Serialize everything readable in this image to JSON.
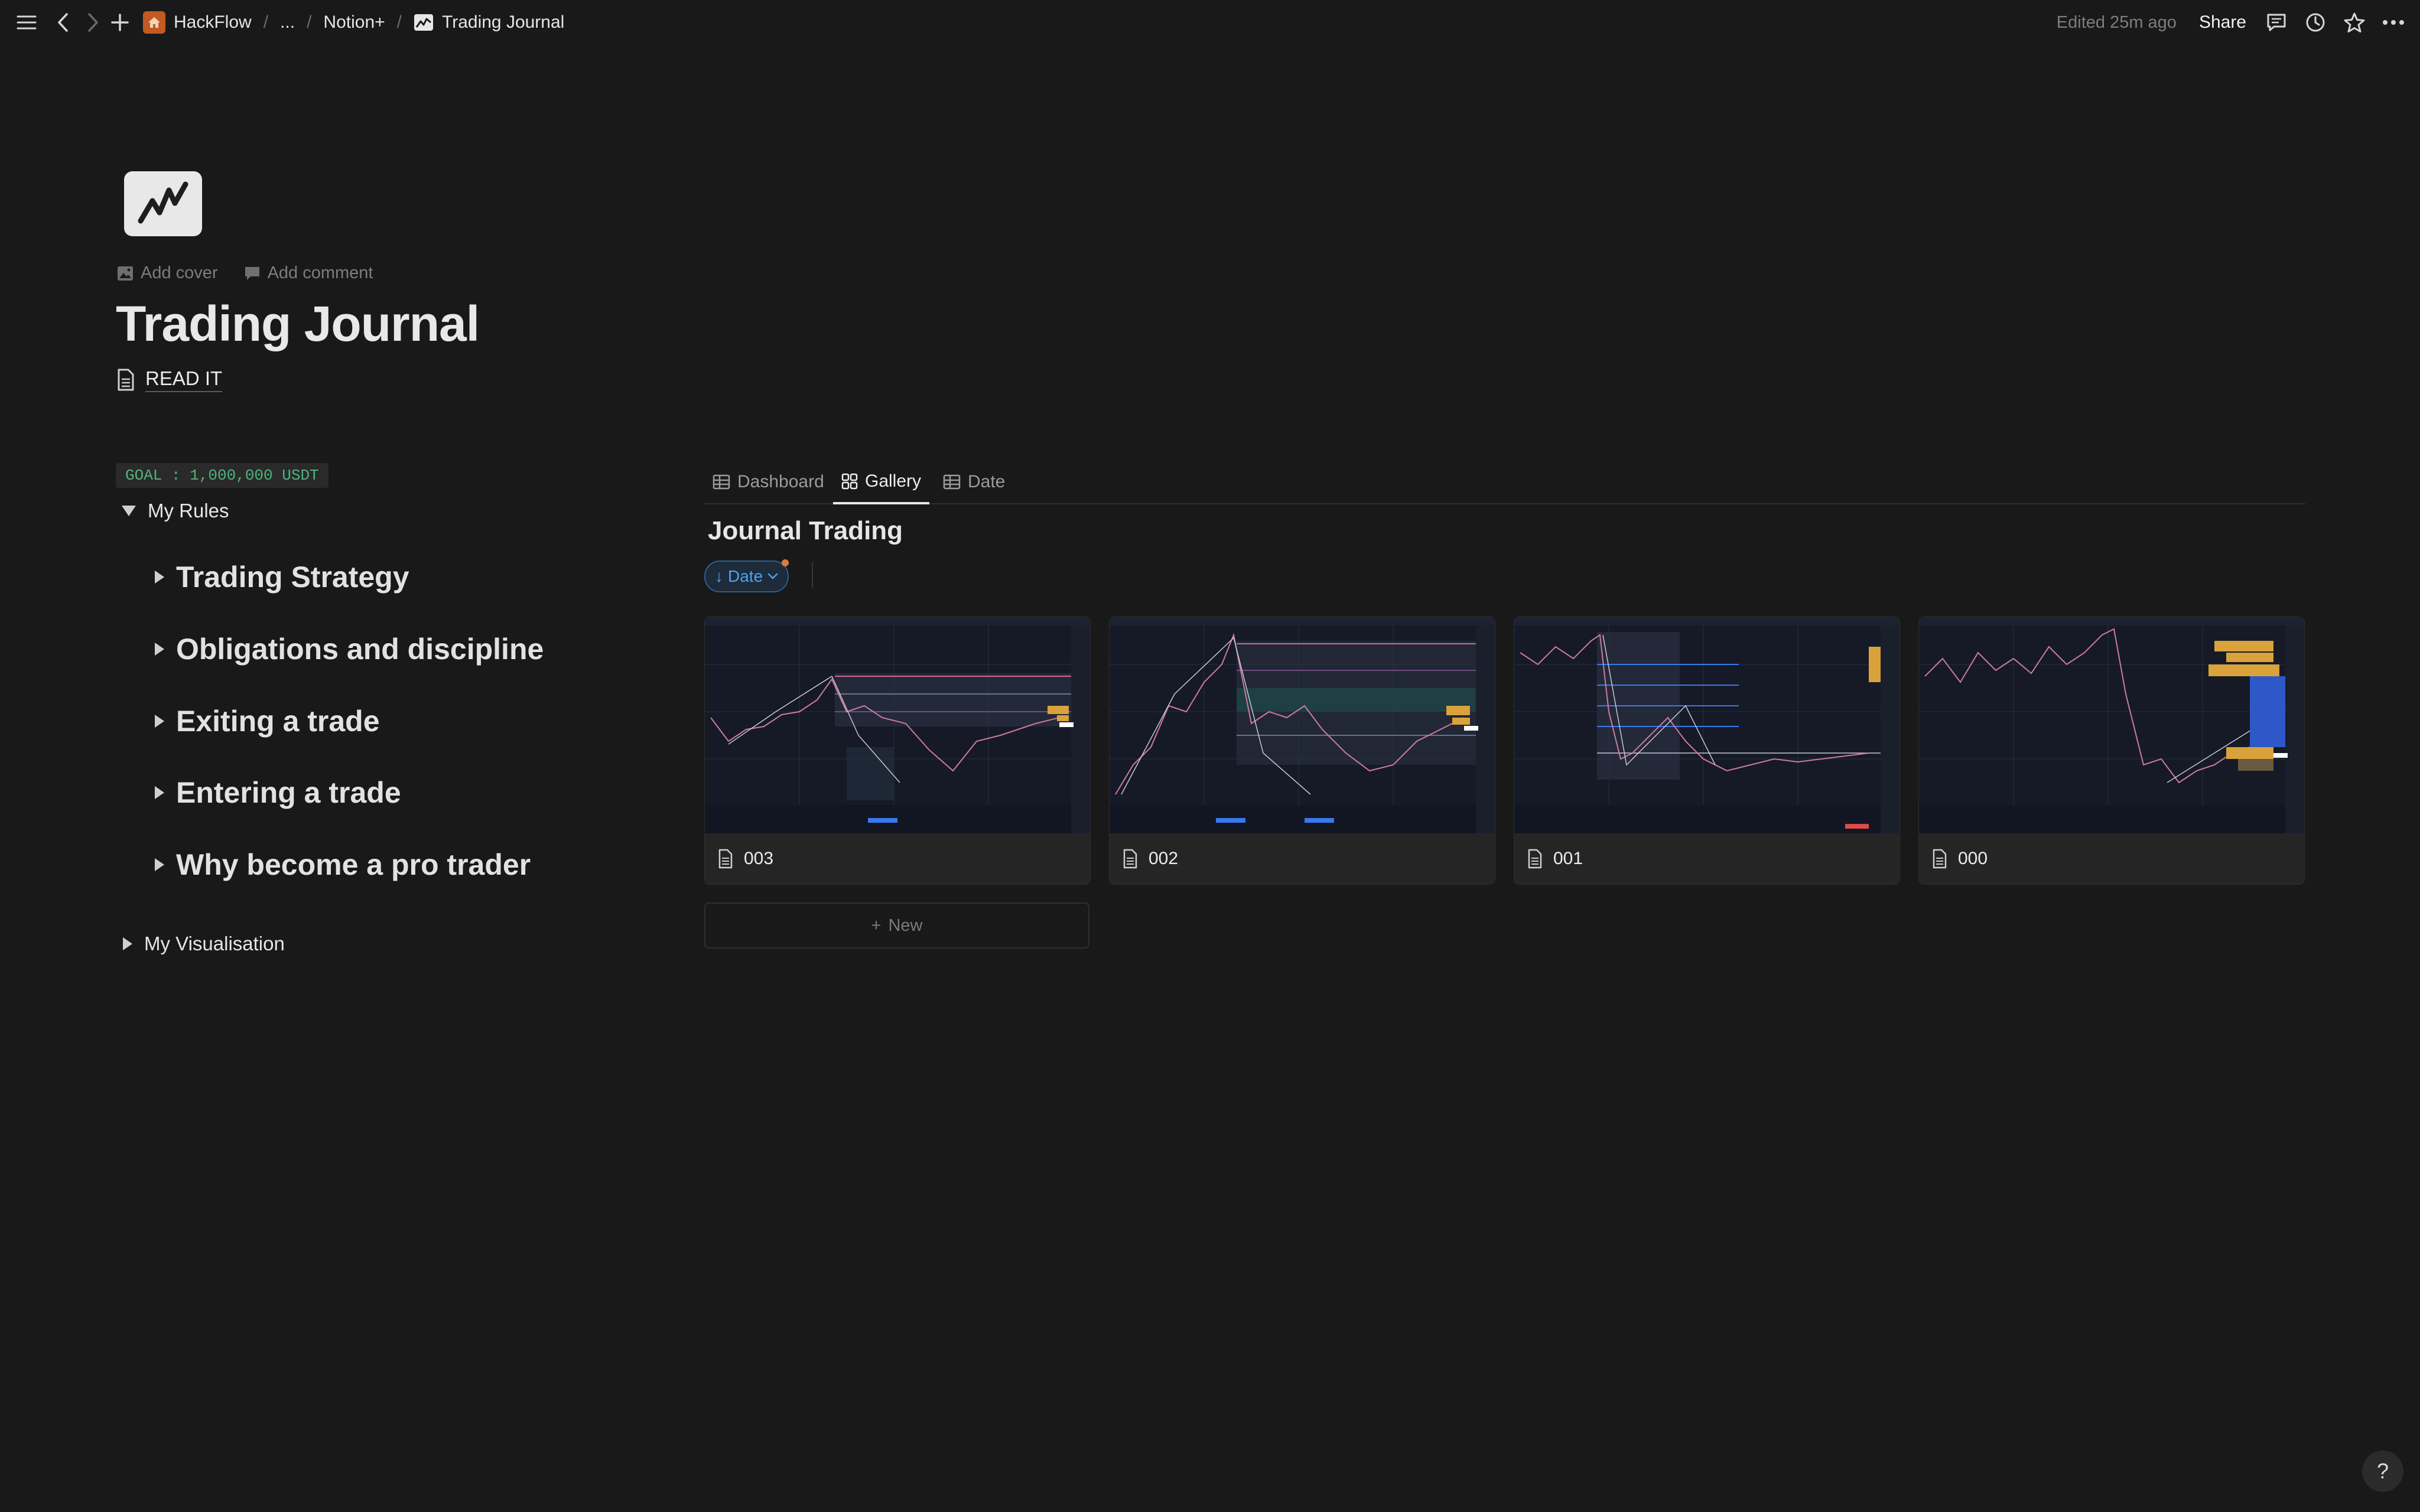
{
  "topbar": {
    "breadcrumbs": [
      "HackFlow",
      "...",
      "Notion+",
      "Trading Journal"
    ],
    "edited": "Edited 25m ago",
    "share": "Share"
  },
  "page": {
    "title": "Trading Journal",
    "add_cover": "Add cover",
    "add_comment": "Add comment",
    "read_it": "READ IT"
  },
  "left": {
    "goal": "GOAL : 1,000,000 USDT",
    "my_rules": "My Rules",
    "rules": [
      "Trading Strategy",
      "Obligations and discipline",
      "Exiting a trade",
      "Entering a trade",
      "Why become a pro trader"
    ],
    "my_visualisation": "My Visualisation"
  },
  "database": {
    "tabs": [
      "Dashboard",
      "Gallery",
      "Date"
    ],
    "active_tab": "Gallery",
    "title": "Journal Trading",
    "sort": "Date",
    "cards": [
      "003",
      "002",
      "001",
      "000"
    ],
    "new": "New"
  },
  "help": "?",
  "colors": {
    "background": "#191919",
    "goal_text": "#4fb37e",
    "sort_accent": "#4da3f0",
    "home_icon": "#c25a22"
  }
}
